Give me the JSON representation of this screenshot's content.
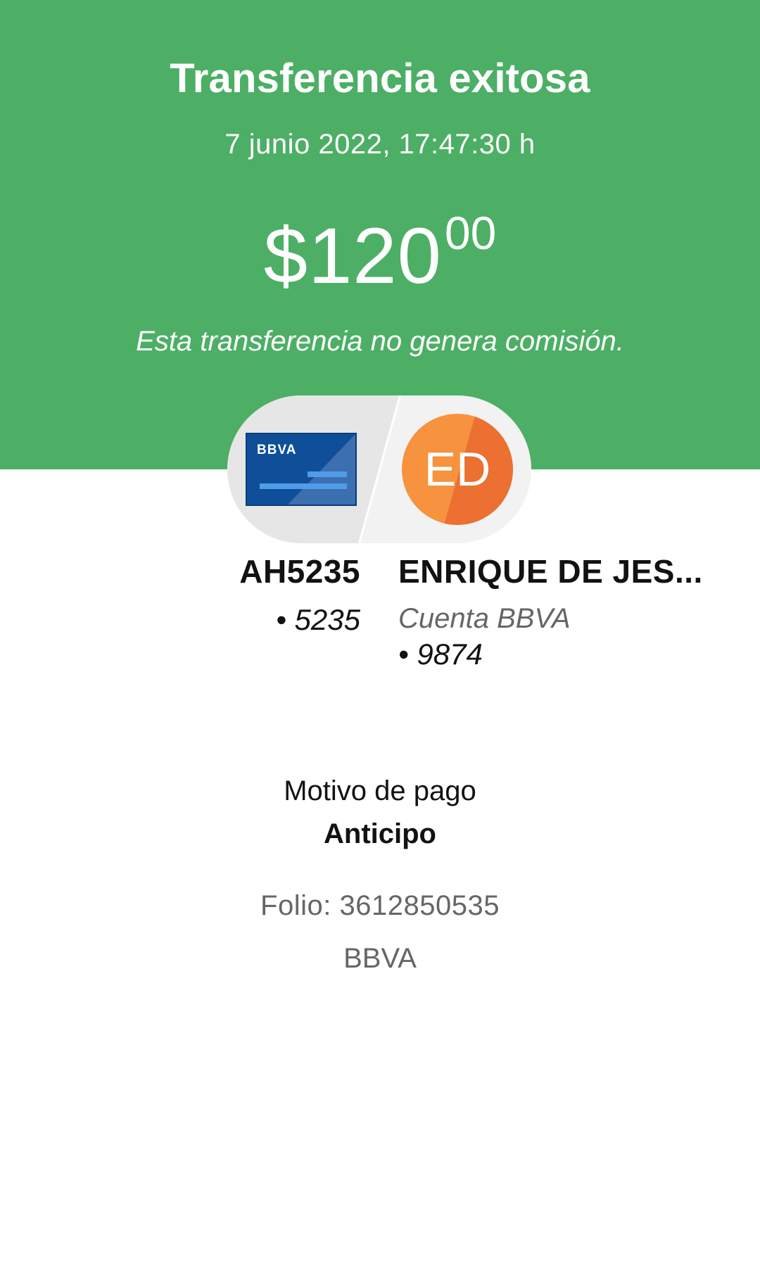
{
  "header": {
    "title": "Transferencia exitosa",
    "datetime": "7 junio 2022, 17:47:30 h",
    "amount_main": "$120",
    "amount_cents": "00",
    "fee_note": "Esta transferencia no genera comisión."
  },
  "origin": {
    "card_logo": "BBVA",
    "name": "AH5235",
    "number": "• 5235"
  },
  "destination": {
    "initials": "ED",
    "name": "ENRIQUE DE JES...",
    "account_type": "Cuenta BBVA",
    "number": "• 9874"
  },
  "details": {
    "reason_label": "Motivo de pago",
    "reason_value": "Anticipo",
    "folio": "Folio: 3612850535",
    "bank": "BBVA"
  },
  "icons": {
    "origin": "bbva-card-icon",
    "destination": "contact-avatar"
  },
  "colors": {
    "header_bg": "#4caf65",
    "avatar_orange": "#f7923e",
    "card_blue": "#0f4f99"
  }
}
